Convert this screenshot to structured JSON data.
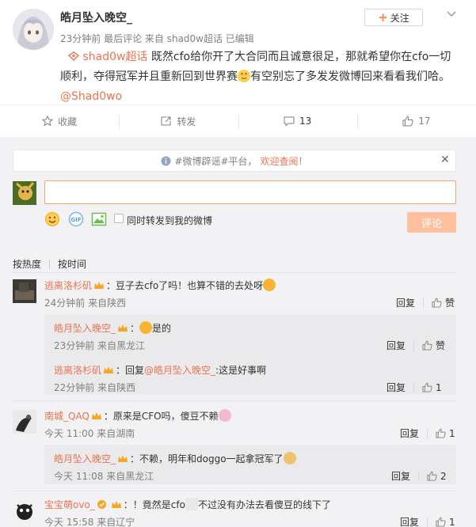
{
  "post": {
    "author": "皓月坠入晚空_",
    "meta": "23分钟前 最后评论 来自 shad0w超话 已编辑",
    "follow_label": "关注",
    "supertopic": "shad0w超话",
    "text_1": "既然cfo给你开了大合同而且诚意很足，那就希望你在cfo一切",
    "text_2": "顺利，夺得冠军并且重新回到世界赛",
    "text_3": "有空别忘了多发发微博回来看看我们哈。",
    "mention": "@Shad0wo"
  },
  "actions": {
    "collect": "收藏",
    "forward": "转发",
    "comment_count": "13",
    "like_count": "17"
  },
  "notice": {
    "prefix": "#微博辟谣#平台，",
    "link": "欢迎查阅！"
  },
  "composer": {
    "forward_label": "同时转发到我的微博",
    "submit_label": "评论"
  },
  "sort": {
    "hot": "按热度",
    "time": "按时间"
  },
  "comments": [
    {
      "name": "逃离洛杉矶",
      "text": "：豆子去cfo了吗！也算不错的去处呀",
      "meta": "24分钟前 来自陕西",
      "reply": "回复",
      "like": "赞",
      "replies": [
        {
          "name": "皓月坠入晚空_",
          "text": "：",
          "text2": "是的",
          "meta": "23分钟前 来自黑龙江",
          "reply": "回复",
          "like": "赞"
        },
        {
          "name": "逃离洛杉矶",
          "text": "：回复",
          "mention": "@皓月坠入晚空_",
          "text2": ":这是好事啊",
          "meta": "22分钟前 来自陕西",
          "reply": "回复",
          "like": "1"
        }
      ]
    },
    {
      "name": "南城_QAQ",
      "text": "：原来是CFO吗，傻豆不赖",
      "meta": "今天 11:00 来自湖南",
      "reply": "回复",
      "like": "1",
      "replies": [
        {
          "name": "皓月坠入晚空_",
          "text": "：不赖，明年和doggo一起拿冠军了",
          "meta": "今天 11:08 来自黑龙江",
          "reply": "回复",
          "like": "2"
        }
      ]
    },
    {
      "name": "宝宝萌ovo_",
      "text": "：！竟然是cfo",
      "text2": "不过没有办法去看傻豆的线下了",
      "meta": "今天 15:58 来自辽宁",
      "reply": "回复",
      "like": "1"
    }
  ],
  "colors": {
    "accent": "#eb7350",
    "background": "#f2f2f5",
    "submit": "#ffc09f"
  }
}
